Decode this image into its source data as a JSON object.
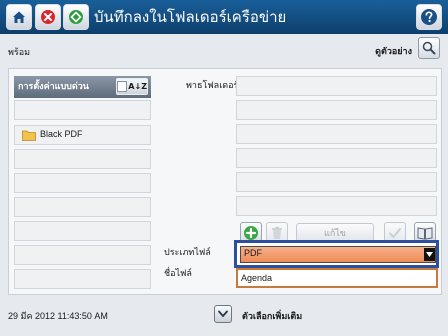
{
  "titlebar": {
    "title": "บันทึกลงในโฟลเดอร์เครือข่าย",
    "home_icon": "home-icon",
    "stop_icon": "stop-icon",
    "start_icon": "start-icon",
    "help_icon": "help-icon",
    "bar_color": "#1a5f9a",
    "stop_color": "#d9272e",
    "start_color": "#2e9e3c"
  },
  "status": {
    "text": "พร้อม",
    "preview_label": "ดูตัวอย่าง"
  },
  "quick_sets": {
    "header": "การตั้งค่าแบบด่วน",
    "sort_label": "A↓Z",
    "items": [
      "Black PDF"
    ]
  },
  "folder": {
    "label": "พาธโฟลเดอร์"
  },
  "toolbar": {
    "edit_label": "แก้ไข"
  },
  "form": {
    "file_type_label": "ประเภทไฟล์",
    "file_type_value": "PDF",
    "file_name_label": "ชื่อไฟล์",
    "file_name_value": "Agenda",
    "highlight_color": "#2d4f9e",
    "select_color": "#ef8b58"
  },
  "footer": {
    "datetime": "29 มีค 2012 11:43:50 AM",
    "more_options_label": "ตัวเลือกเพิ่มเติม"
  }
}
